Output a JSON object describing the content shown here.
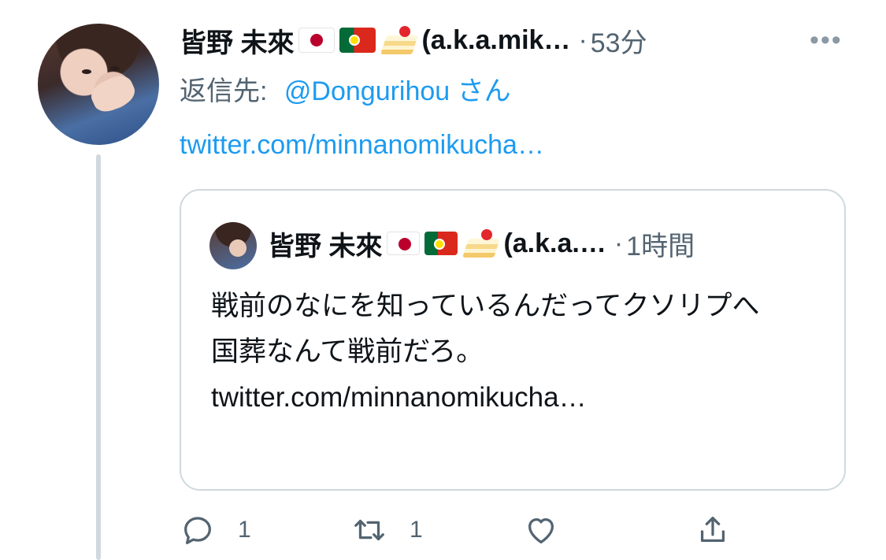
{
  "tweet": {
    "display_name": "皆野 未來",
    "handle_suffix": "(a.k.a.mik…",
    "separator": "·",
    "time": "53分",
    "more_label": "•••",
    "reply_prefix": "返信先:",
    "reply_handle": "@Dongurihou",
    "reply_suffix": "さん",
    "link_text": "twitter.com/minnanomikucha…",
    "name_emojis": [
      "flag-japan",
      "flag-portugal",
      "shortcake"
    ]
  },
  "quoted": {
    "display_name": "皆野 未來",
    "handle_suffix": "(a.k.a.…",
    "separator": "·",
    "time": "1時間",
    "lines": [
      "戦前のなにを知っているんだってクソリプへ",
      "国葬なんて戦前だろ。 twitter.com/minnanomikucha…"
    ]
  },
  "actions": {
    "reply_count": "1",
    "retweet_count": "1",
    "like_count": "",
    "share_count": ""
  },
  "colors": {
    "link": "#1d9bf0",
    "secondary_text": "#536471",
    "border": "#cfd9de"
  },
  "icons": [
    "reply-icon",
    "retweet-icon",
    "like-icon",
    "share-icon",
    "more-icon"
  ]
}
